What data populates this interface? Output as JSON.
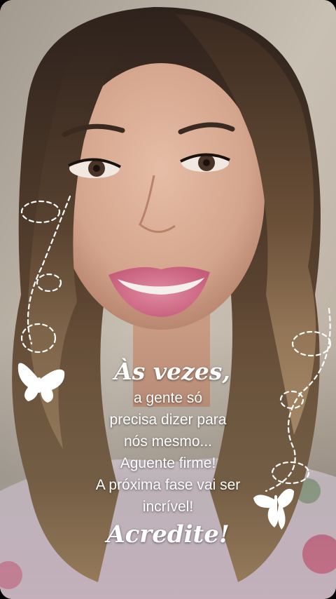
{
  "story": {
    "photo_alt_icon": "portrait-photo",
    "quote": {
      "title": "Às vezes,",
      "lines": [
        "a gente só",
        "precisa dizer para",
        "nós mesmo...",
        "Aguente firme!",
        "A próxima fase vai ser",
        "incrível!"
      ],
      "closing": "Acredite!"
    },
    "colors": {
      "text": "#ffffff",
      "lipstick": "#d9738e",
      "hair": "#3a2a22",
      "skin": "#d9ae98"
    }
  }
}
